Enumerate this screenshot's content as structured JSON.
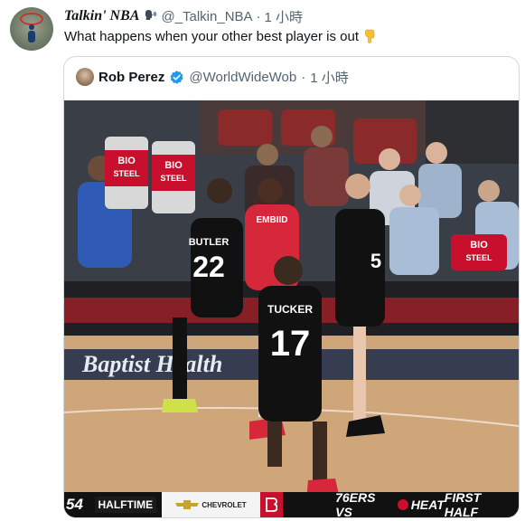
{
  "tweet": {
    "display_name": "Talkin' NBA",
    "speaking_icon": "speaking-head-icon",
    "handle": "@_Talkin_NBA",
    "separator": "·",
    "time": "1 小時",
    "text": "What happens when your other best player is out",
    "emoji": "backhand-index-pointing-down-icon"
  },
  "quote": {
    "display_name": "Rob Perez",
    "verified_icon": "verified-badge-icon",
    "handle": "@WorldWideWob",
    "separator": "·",
    "time": "1 小時"
  },
  "media": {
    "ad_text_1": "BIO",
    "ad_text_2": "STEEL",
    "ad_text_3": "BIO",
    "ad_text_4": "STEEL",
    "ad_text_5": "BIO",
    "ad_text_6": "STEEL",
    "jersey_butler_name": "BUTLER",
    "jersey_butler_number": "22",
    "jersey_tucker_name": "TUCKER",
    "jersey_tucker_number": "17",
    "jersey_embiid_name": "EMBIID",
    "jersey_dragic_number": "5",
    "baseline_text": "Baptist Health"
  },
  "scorebug": {
    "score": "54",
    "period": "HALFTIME",
    "sponsor": "CHEVROLET",
    "matchup": "76ERS VS",
    "team": "HEAT",
    "label": "FIRST HALF"
  },
  "colors": {
    "accent_blue": "#1d9bf0",
    "heat_red": "#c8102e",
    "muted_text": "#536471"
  }
}
